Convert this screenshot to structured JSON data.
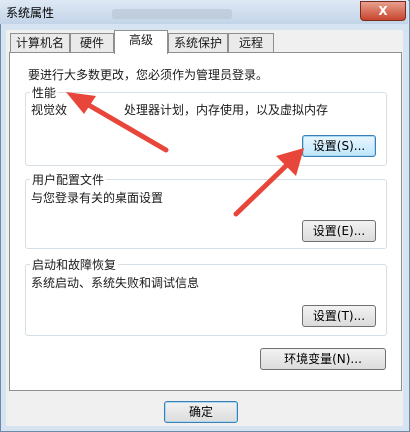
{
  "window": {
    "title": "系统属性",
    "close_glyph": "X"
  },
  "tabs": [
    {
      "label": "计算机名"
    },
    {
      "label": "硬件"
    },
    {
      "label": "高级",
      "active": true
    },
    {
      "label": "系统保护"
    },
    {
      "label": "远程"
    }
  ],
  "panel": {
    "admin_note": "要进行大多数更改，您必须作为管理员登录。",
    "performance": {
      "title": "性能",
      "description_part1": "视觉效",
      "description_part2": "处理器计划，内存使用，以及虚拟内存",
      "button": "设置(S)..."
    },
    "profile": {
      "title": "用户配置文件",
      "description": "与您登录有关的桌面设置",
      "button": "设置(E)..."
    },
    "startup": {
      "title": "启动和故障恢复",
      "description": "系统启动、系统失败和调试信息",
      "button": "设置(T)..."
    },
    "env_button": "环境变量(N)..."
  },
  "footer": {
    "ok_button": "确定"
  },
  "annotation_color": "#e8463a"
}
